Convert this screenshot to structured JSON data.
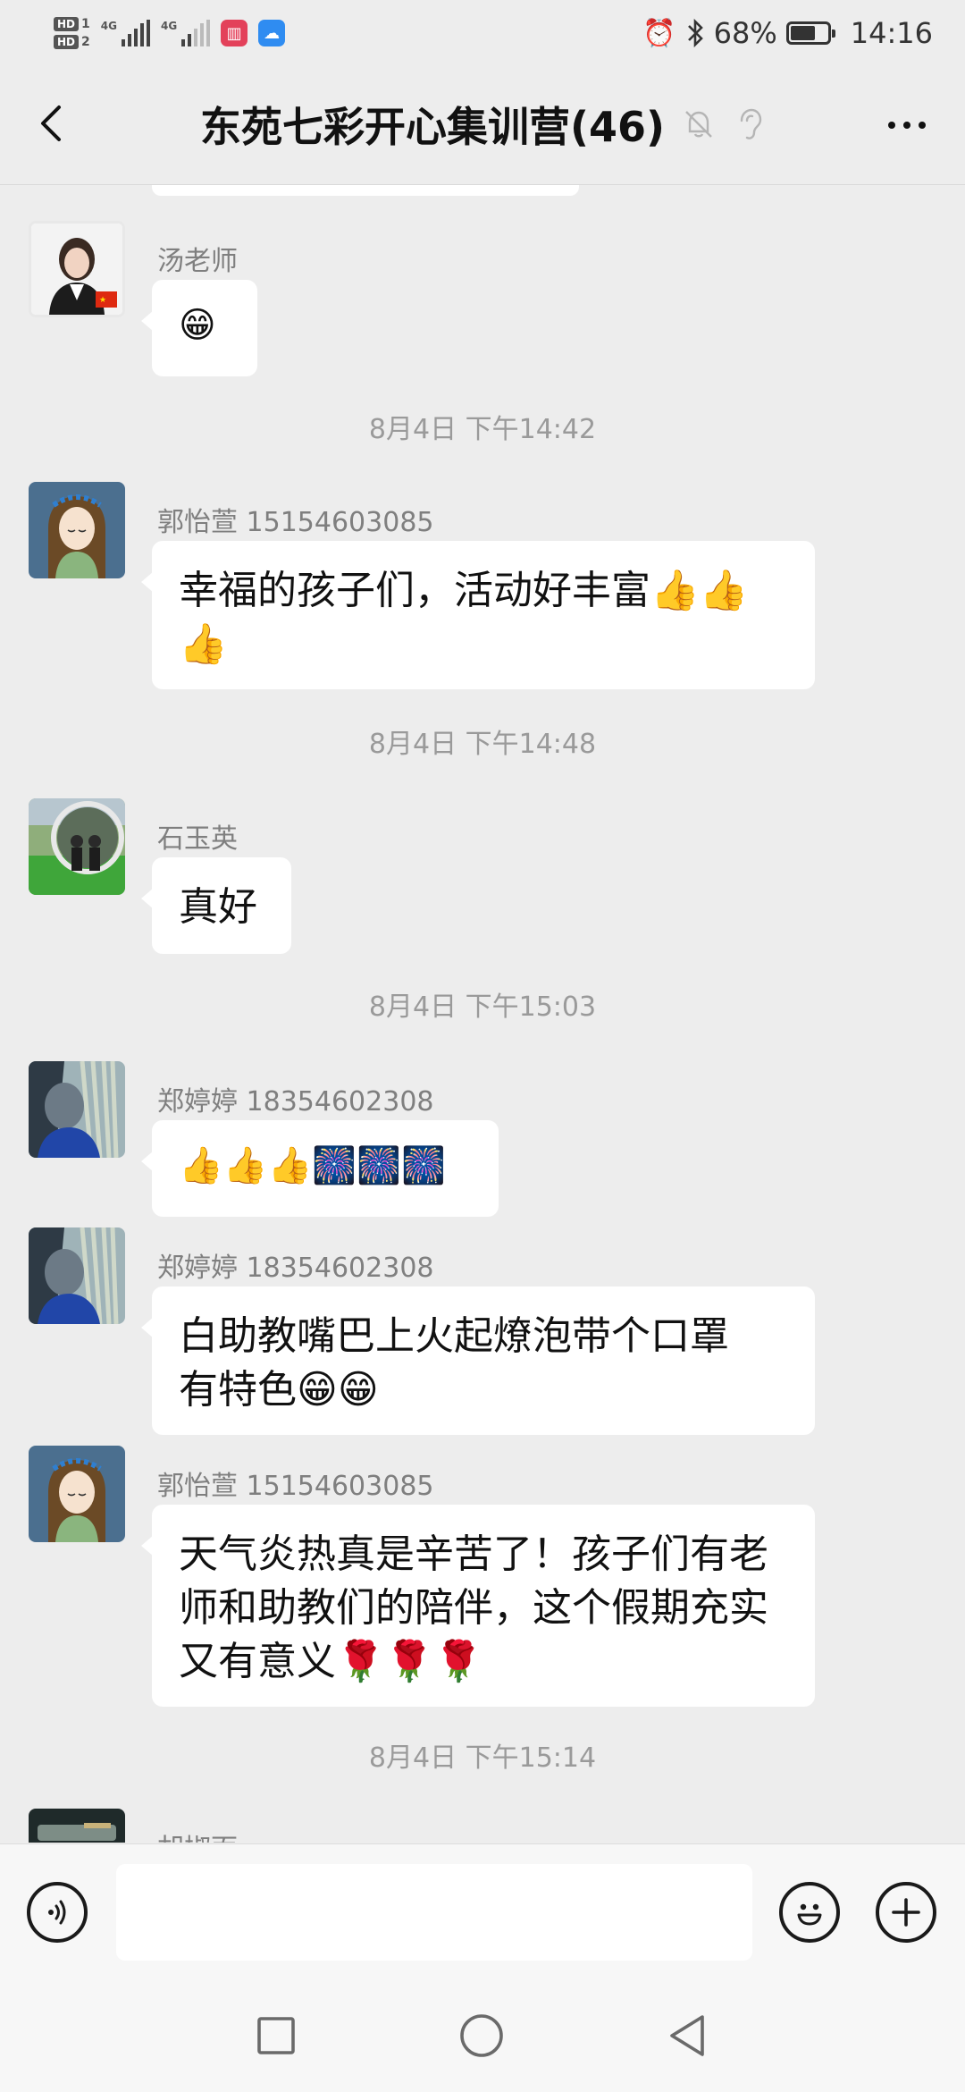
{
  "status_bar": {
    "hd1": "HD",
    "hd1_num": "1",
    "hd2": "HD",
    "hd2_num": "2",
    "net1": "4G",
    "net2": "4G",
    "battery_text": "68%",
    "battery_level": 0.68,
    "time": "14:16"
  },
  "header": {
    "title": "东苑七彩开心集训营(46)",
    "back_icon": "chevron-left-icon",
    "mute_icon": "bell-off-icon",
    "ear_icon": "ear-icon",
    "more_icon": "more-dots-icon"
  },
  "messages": [
    {
      "sender": "汤老师",
      "text": "😁"
    },
    {
      "time": "8月4日 下午14:42"
    },
    {
      "sender": "郭怡萱 15154603085",
      "line1": "幸福的孩子们，活动好丰富👍👍",
      "line2": "👍"
    },
    {
      "time": "8月4日 下午14:48"
    },
    {
      "sender": "石玉英",
      "text": "真好"
    },
    {
      "time": "8月4日 下午15:03"
    },
    {
      "sender": "郑婷婷 18354602308",
      "text": "👍👍👍🎆🎆🎆"
    },
    {
      "sender": "郑婷婷 18354602308",
      "line1": "白助教嘴巴上火起燎泡带个口罩",
      "line2": "有特色😁😁"
    },
    {
      "sender": "郭怡萱 15154603085",
      "line1": "天气炎热真是辛苦了！孩子们有老",
      "line2": "师和助教们的陪伴，这个假期充实",
      "line3": "又有意义🌹🌹🌹"
    },
    {
      "time": "8月4日 下午15:14"
    },
    {
      "sender": "胡椒面"
    }
  ],
  "input_bar": {
    "voice_icon": "voice-icon",
    "emoji_icon": "emoji-icon",
    "plus_icon": "plus-icon",
    "input_value": ""
  },
  "nav_bar": {
    "recents_icon": "square-icon",
    "home_icon": "circle-icon",
    "back_icon": "triangle-back-icon"
  },
  "colors": {
    "background": "#ededed",
    "bubble": "#ffffff",
    "timestamp": "#9a9a9a",
    "sender_name": "#7f7f7f"
  }
}
